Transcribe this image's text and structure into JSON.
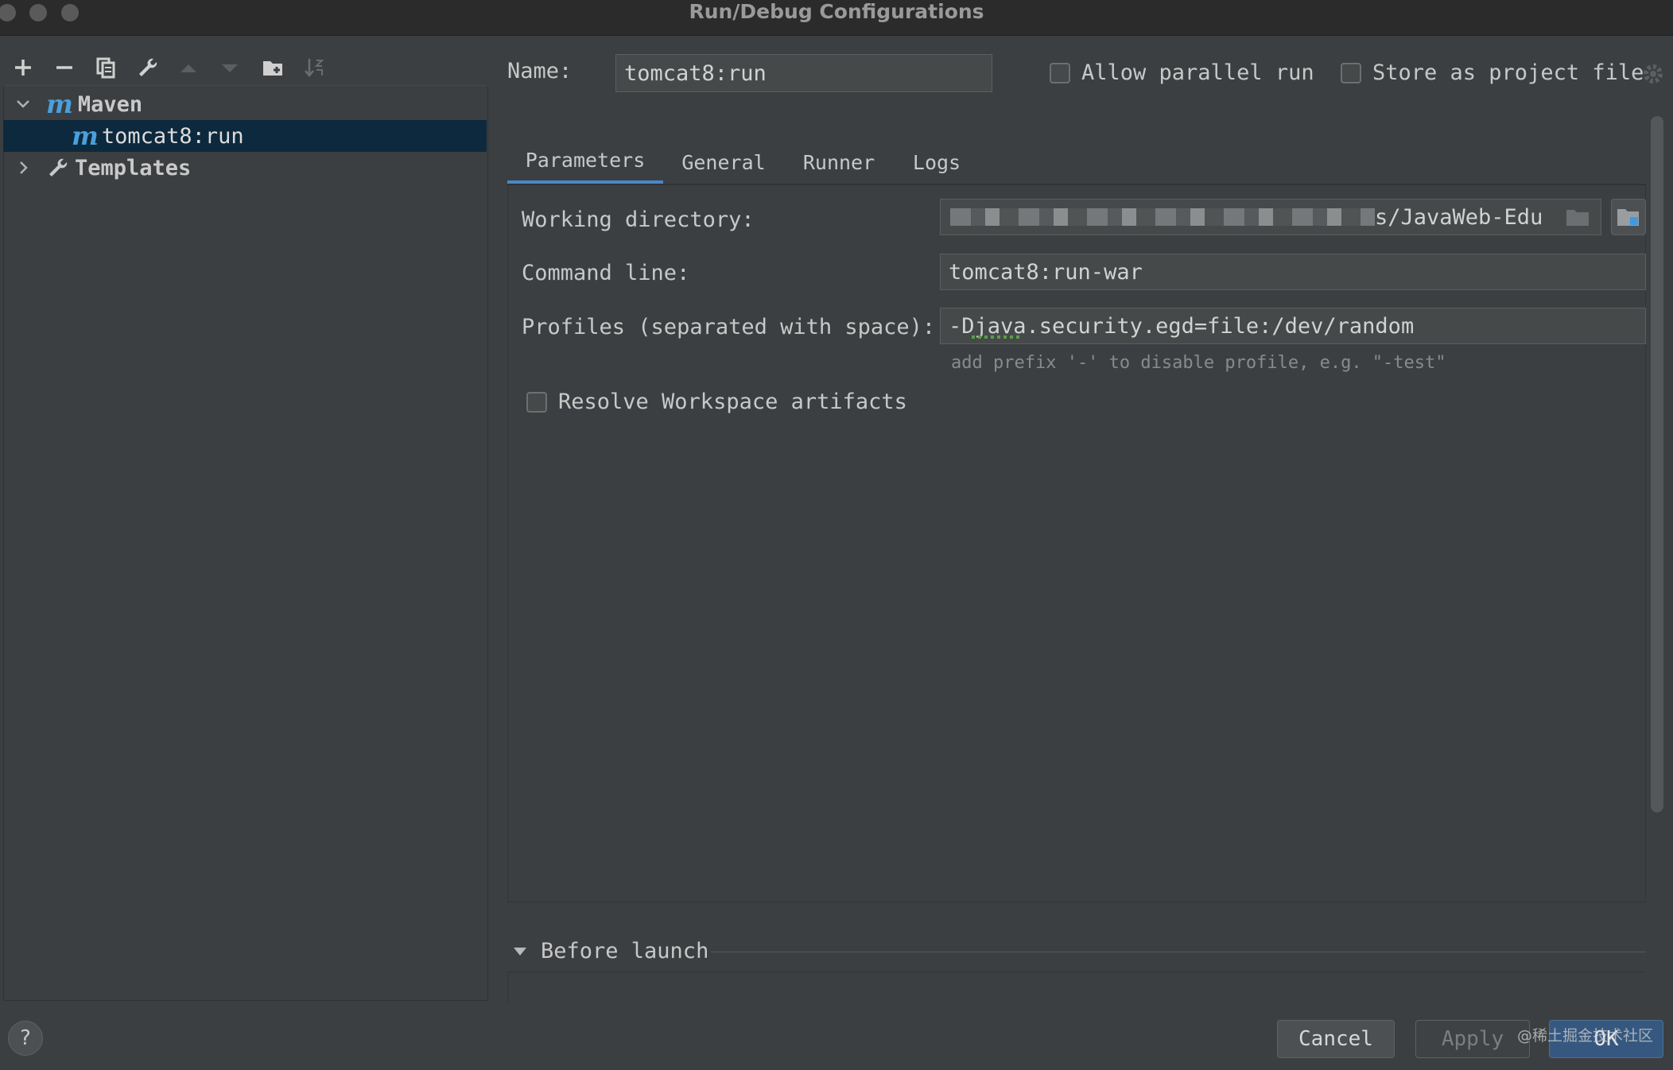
{
  "window": {
    "title": "Run/Debug Configurations"
  },
  "toolbar": {
    "icons": [
      "add-icon",
      "remove-icon",
      "copy-icon",
      "edit-templates-icon",
      "move-up-icon",
      "move-down-icon",
      "new-folder-icon",
      "sort-icon"
    ]
  },
  "tree": {
    "maven": {
      "icon": "m",
      "label": "Maven"
    },
    "config": {
      "icon": "m",
      "label": "tomcat8:run"
    },
    "templates": {
      "label": "Templates"
    }
  },
  "form": {
    "name_label": "Name:",
    "name_value": "tomcat8:run",
    "allow_parallel_label": "Allow parallel run",
    "store_project_label": "Store as project file",
    "allow_parallel_checked": false,
    "store_project_checked": false
  },
  "tabs": [
    {
      "label": "Parameters",
      "active": true
    },
    {
      "label": "General",
      "active": false
    },
    {
      "label": "Runner",
      "active": false
    },
    {
      "label": "Logs",
      "active": false
    }
  ],
  "parameters": {
    "working_dir_label": "Working directory:",
    "working_dir_value": "s/JavaWeb-Edu",
    "command_line_label": "Command line:",
    "command_line_value": "tomcat8:run-war",
    "profiles_label": "Profiles (separated with space):",
    "profiles_value": "-Djava.security.egd=file:/dev/random",
    "profiles_hint": "add prefix '-' to disable profile, e.g. \"-test\"",
    "resolve_label": "Resolve Workspace artifacts",
    "resolve_checked": false
  },
  "before_launch": {
    "label": "Before launch"
  },
  "buttons": {
    "help": "?",
    "cancel": "Cancel",
    "apply": "Apply",
    "ok": "OK"
  },
  "watermark": "@稀土掘金技术社区",
  "colors": {
    "background": "#3c3f41",
    "selection": "#0d293e",
    "accent": "#4a88c7",
    "maven_icon": "#4a9fdc"
  }
}
